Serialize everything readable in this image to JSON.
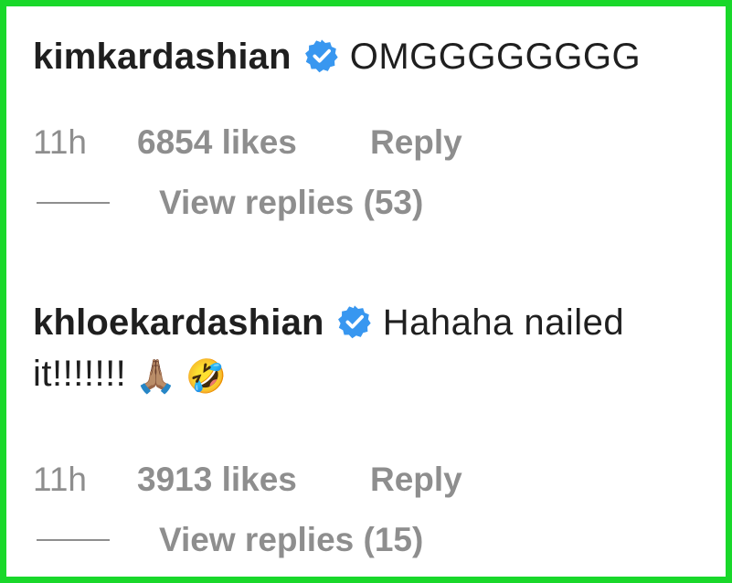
{
  "colors": {
    "border": "#19d82a",
    "verified_badge": "#3897f0",
    "meta_text": "#8e8e8e",
    "primary_text": "#1f1f1f"
  },
  "comments": [
    {
      "username": "kimkardashian",
      "verified": true,
      "text": "OMGGGGGGGG",
      "emojis": [],
      "time": "11h",
      "likes": "6854 likes",
      "reply_label": "Reply",
      "view_replies": "View replies (53)"
    },
    {
      "username": "khloekardashian",
      "verified": true,
      "text": "Hahaha nailed it!!!!!!!",
      "emojis": [
        "🙏🏽",
        "🤣"
      ],
      "time": "11h",
      "likes": "3913 likes",
      "reply_label": "Reply",
      "view_replies": "View replies (15)"
    }
  ]
}
